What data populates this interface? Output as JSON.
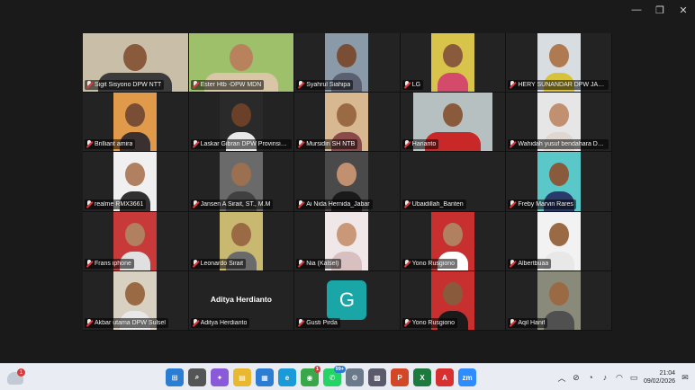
{
  "window": {
    "controls": {
      "minimize": "—",
      "maximize": "❐",
      "close": "✕"
    }
  },
  "participants": [
    {
      "name": "Sigit Sisyono DPW NTT",
      "kind": "video",
      "bg": "#c9bfa8",
      "skin": "#8a5a3c",
      "shirt": "#3b3b3b",
      "fit": "full"
    },
    {
      "name": "Ester Htb -DPW MDN",
      "kind": "video",
      "bg": "#9fc06a",
      "skin": "#b8835c",
      "shirt": "#d8c6a6",
      "fit": "full"
    },
    {
      "name": "Syahrul Siahipa",
      "kind": "video",
      "bg": "#8a9aa8",
      "skin": "#7a4e34",
      "shirt": "#5a6070",
      "fit": "center"
    },
    {
      "name": "LG",
      "kind": "video",
      "bg": "#d8c44a",
      "skin": "#8a5a3c",
      "shirt": "#d44a6a",
      "fit": "center"
    },
    {
      "name": "HERY SUNANDAR DPW JABAR",
      "kind": "video",
      "bg": "#d8dde2",
      "skin": "#b07a50",
      "shirt": "#d8c23a",
      "fit": "center"
    },
    {
      "name": "Brilliant amira",
      "kind": "video",
      "bg": "#e09a4a",
      "skin": "#7a4e34",
      "shirt": "#3a3030",
      "fit": "center"
    },
    {
      "name": "Laskar Gibran DPW Provinsi B...",
      "kind": "video",
      "bg": "#2a2a2a",
      "skin": "#6a4028",
      "shirt": "#e8e8e8",
      "fit": "center"
    },
    {
      "name": "Mursidin SH NTB",
      "kind": "video",
      "bg": "#d8b890",
      "skin": "#9a6a44",
      "shirt": "#8a4a4a",
      "fit": "center"
    },
    {
      "name": "Harianto",
      "kind": "video",
      "bg": "#b7c0c0",
      "skin": "#8a5a3c",
      "shirt": "#c82828",
      "fit": "centerwide"
    },
    {
      "name": "Wahidah yusuf bendahara DP...",
      "kind": "video",
      "bg": "#e6e6e6",
      "skin": "#c09070",
      "shirt": "#e0d8d0",
      "fit": "center"
    },
    {
      "name": "realme RMX3661",
      "kind": "video",
      "bg": "#f0f0f0",
      "skin": "#b08060",
      "shirt": "#303030",
      "fit": "center"
    },
    {
      "name": "Jansen A Sirait, ST., M.M",
      "kind": "video",
      "bg": "#6a6a6a",
      "skin": "#9a7050",
      "shirt": "#404040",
      "fit": "center"
    },
    {
      "name": "Ai Nida Hernida_Jabar",
      "kind": "video",
      "bg": "#4a4a4a",
      "skin": "#c09070",
      "shirt": "#1a1a1a",
      "fit": "center"
    },
    {
      "name": "Ubaidillah_Banten",
      "kind": "empty"
    },
    {
      "name": "Freby Marvin Rares",
      "kind": "video",
      "bg": "#5ac8c8",
      "skin": "#8a5a3c",
      "shirt": "#2a3a6a",
      "fit": "center"
    },
    {
      "name": "Frans iphone",
      "kind": "video",
      "bg": "#c83a3a",
      "skin": "#b08060",
      "shirt": "#e0e0e0",
      "fit": "center"
    },
    {
      "name": "Leonardo Sirait",
      "kind": "video",
      "bg": "#c8b870",
      "skin": "#9a6a44",
      "shirt": "#6a6a6a",
      "fit": "center"
    },
    {
      "name": "Nia (Kalsel)",
      "kind": "video",
      "bg": "#f0e8e8",
      "skin": "#c89878",
      "shirt": "#d8c0c0",
      "fit": "center"
    },
    {
      "name": "Yono Rusgiono",
      "kind": "video",
      "bg": "#c83030",
      "skin": "#b08060",
      "shirt": "#ffffff",
      "fit": "center"
    },
    {
      "name": "Albertbuaa",
      "kind": "video",
      "bg": "#f2f2f2",
      "skin": "#9a6a44",
      "shirt": "#e8e8e8",
      "fit": "center"
    },
    {
      "name": "Akbar utama DPW Sulsel",
      "kind": "video",
      "bg": "#d8d0c0",
      "skin": "#9a6a44",
      "shirt": "#e8e8e8",
      "fit": "center"
    },
    {
      "name": "Aditya Herdianto",
      "kind": "nameonly",
      "display": "Aditya Herdianto"
    },
    {
      "name": "Gusti Pirda",
      "kind": "avatar",
      "letter": "G",
      "color": "#1aa6a6"
    },
    {
      "name": "Yono Rusgiono",
      "kind": "video",
      "bg": "#c83030",
      "skin": "#8a5a3c",
      "shirt": "#1a1a1a",
      "fit": "center"
    },
    {
      "name": "Aqil Hanif",
      "kind": "video",
      "bg": "#8a8a7a",
      "skin": "#9a6a44",
      "shirt": "#505050",
      "fit": "center"
    }
  ],
  "taskbar": {
    "weather_badge": "1",
    "apps": [
      {
        "id": "start",
        "glyph": "⊞",
        "color": "#2b7cd3"
      },
      {
        "id": "search",
        "glyph": "⌕",
        "color": "#555555"
      },
      {
        "id": "copilot",
        "glyph": "✦",
        "color": "#8a5ad8"
      },
      {
        "id": "files",
        "glyph": "▤",
        "color": "#e8b830"
      },
      {
        "id": "store",
        "glyph": "▦",
        "color": "#2b7cd3"
      },
      {
        "id": "edge",
        "glyph": "e",
        "color": "#1a9ad8"
      },
      {
        "id": "chrome",
        "glyph": "◉",
        "color": "#3aa84a",
        "badge": "1",
        "badge_red": true
      },
      {
        "id": "whatsapp",
        "glyph": "✆",
        "color": "#25d366",
        "badge": "99+"
      },
      {
        "id": "settings",
        "glyph": "⚙",
        "color": "#6a7a8a"
      },
      {
        "id": "calculator",
        "glyph": "▩",
        "color": "#5a5a6a"
      },
      {
        "id": "powerpoint",
        "glyph": "P",
        "color": "#d24726"
      },
      {
        "id": "excel",
        "glyph": "X",
        "color": "#1d7a3e"
      },
      {
        "id": "acrobat",
        "glyph": "A",
        "color": "#d83030"
      },
      {
        "id": "zoom",
        "glyph": "zm",
        "color": "#2d8cff"
      }
    ],
    "tray": {
      "icons": [
        "chevron-up",
        "network",
        "eye",
        "mic",
        "wifi",
        "battery"
      ],
      "time": "21:04",
      "date": "09/02/2026",
      "notify": "✉"
    }
  }
}
